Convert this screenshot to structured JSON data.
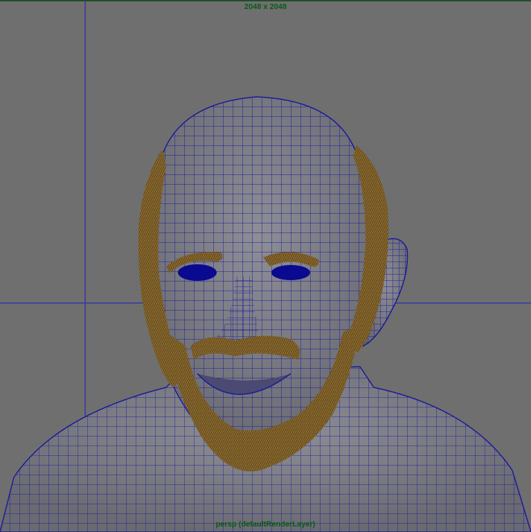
{
  "viewport": {
    "resolution_label": "2048 x 2048",
    "camera_label": "persp (defaultRenderLayer)"
  },
  "colors": {
    "background": "#6f6f6f",
    "grid_lines": "#2a2ab0",
    "wireframe": "#1a1a9a",
    "skin": "#7d7d85",
    "hair": "#8a6a30",
    "eyes": "#0a0a90",
    "hud_text": "#0a5a14"
  }
}
